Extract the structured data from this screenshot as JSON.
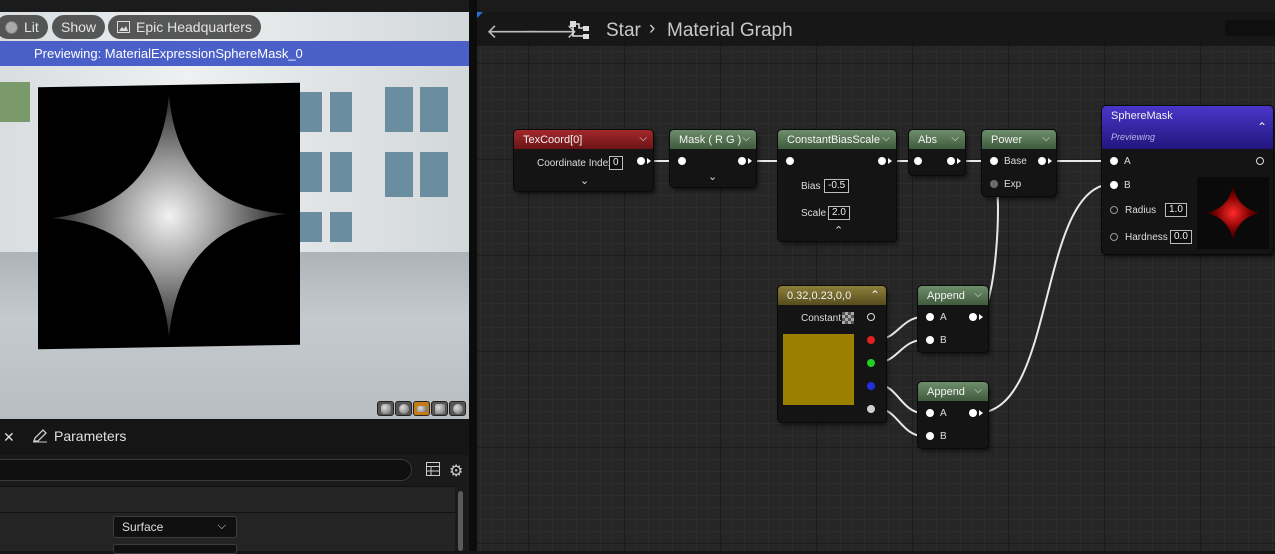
{
  "viewport": {
    "lit_label": "Lit",
    "show_label": "Show",
    "scene_label": "Epic Headquarters",
    "preview_text": "Previewing: MaterialExpressionSphereMask_0"
  },
  "details": {
    "parameters_tab": "Parameters",
    "surface_value": "Surface"
  },
  "graph": {
    "breadcrumb_root": "Star",
    "breadcrumb_page": "Material Graph",
    "nodes": {
      "texcoord": {
        "title": "TexCoord[0]",
        "coord_label": "Coordinate Index",
        "coord_value": "0"
      },
      "mask": {
        "title": "Mask ( R G )"
      },
      "cbs": {
        "title": "ConstantBiasScale",
        "bias_label": "Bias",
        "bias_value": "-0.5",
        "scale_label": "Scale",
        "scale_value": "2.0"
      },
      "abs": {
        "title": "Abs"
      },
      "power": {
        "title": "Power",
        "base_label": "Base",
        "exp_label": "Exp"
      },
      "spheremask": {
        "title": "SphereMask",
        "subtitle": "Previewing",
        "a_label": "A",
        "b_label": "B",
        "radius_label": "Radius",
        "radius_value": "1.0",
        "hardness_label": "Hardness",
        "hardness_value": "0.0"
      },
      "constant": {
        "title": "0.32,0.23,0,0",
        "label": "Constant",
        "swatch_color": "#9a7f00"
      },
      "append1": {
        "title": "Append",
        "a_label": "A",
        "b_label": "B"
      },
      "append2": {
        "title": "Append",
        "a_label": "A",
        "b_label": "B"
      }
    }
  }
}
